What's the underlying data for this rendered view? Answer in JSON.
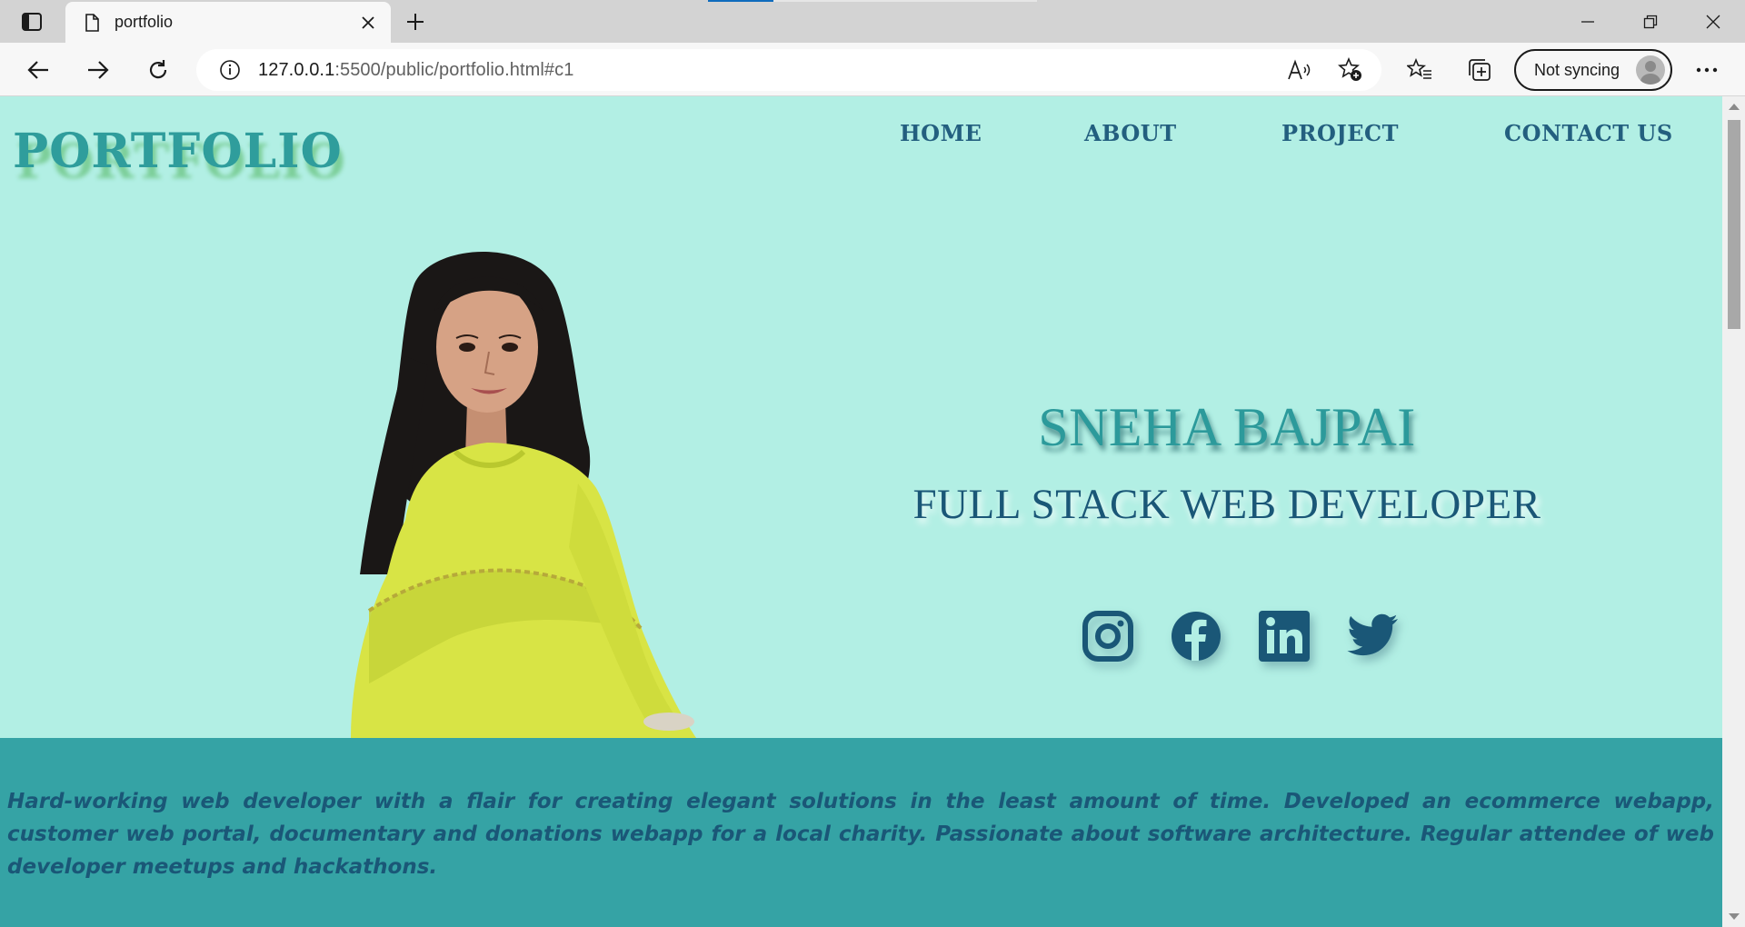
{
  "browser": {
    "tab": {
      "title": "portfolio"
    },
    "address": {
      "host": "127.0.0.1",
      "rest": ":5500/public/portfolio.html#c1"
    },
    "profile": {
      "label": "Not syncing"
    }
  },
  "site": {
    "logo": "PORTFOLIO",
    "nav": [
      {
        "label": "HOME"
      },
      {
        "label": "ABOUT"
      },
      {
        "label": "PROJECT"
      },
      {
        "label": "CONTACT US"
      }
    ],
    "hero": {
      "name": "SNEHA BAJPAI",
      "role": "FULL STACK WEB DEVELOPER"
    },
    "social": [
      "instagram-icon",
      "facebook-icon",
      "linkedin-icon",
      "twitter-icon"
    ],
    "about": {
      "text": "Hard-working web developer with a flair for creating elegant solutions in the least amount of time. Developed an ecommerce webapp, customer web portal, documentary and donations webapp for a local charity. Passionate about software architecture. Regular attendee of web developer meetups and hackathons."
    }
  },
  "colors": {
    "hero_bg": "#b2efe4",
    "about_bg": "#35a3a5",
    "accent_dark": "#1a5777",
    "accent_teal": "#2c9a9b"
  }
}
